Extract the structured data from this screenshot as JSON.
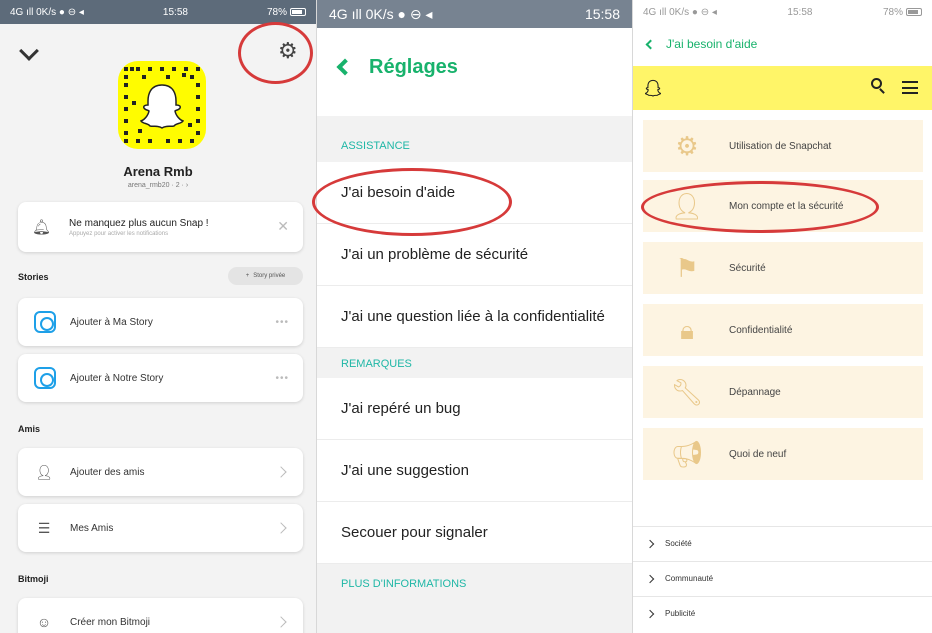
{
  "panel1": {
    "status": {
      "left": "4G ıll 0K/s ● ⊖ ◂",
      "time": "15:58",
      "battery": "78%"
    },
    "profile": {
      "name": "Arena Rmb",
      "username": "arena_rmb20 · 2 · ›"
    },
    "notification": {
      "title": "Ne manquez plus aucun Snap !",
      "subtitle": "Appuyez pour activer les notifications",
      "close": "✕"
    },
    "stories_header": "Stories",
    "private_story_button": "Story privée",
    "stories": [
      {
        "label": "Ajouter à Ma Story"
      },
      {
        "label": "Ajouter à Notre Story"
      }
    ],
    "friends_header": "Amis",
    "friends": [
      {
        "label": "Ajouter des amis"
      },
      {
        "label": "Mes Amis"
      }
    ],
    "bitmoji_header": "Bitmoji",
    "bitmoji": [
      {
        "label": "Créer mon Bitmoji"
      }
    ]
  },
  "panel2": {
    "status": {
      "left": "4G ıll 0K/s ● ⊖ ◂",
      "time": "15:58"
    },
    "title": "Réglages",
    "sections": [
      {
        "header": "ASSISTANCE",
        "items": [
          "J'ai besoin d'aide",
          "J'ai un problème de sécurité",
          "J'ai une question liée à la confidentialité"
        ]
      },
      {
        "header": "REMARQUES",
        "items": [
          "J'ai repéré un bug",
          "J'ai une suggestion",
          "Secouer pour signaler"
        ]
      },
      {
        "header": "PLUS D'INFORMATIONS",
        "items": []
      }
    ]
  },
  "panel3": {
    "status": {
      "left": "4G ıll 0K/s ● ⊖ ◂",
      "time": "15:58",
      "battery": "78%"
    },
    "back_label": "J'ai besoin d'aide",
    "categories": [
      {
        "label": "Utilisation de Snapchat",
        "icon": "ghost-gear-icon"
      },
      {
        "label": "Mon compte et la sécurité",
        "icon": "account-icon"
      },
      {
        "label": "Sécurité",
        "icon": "flag-icon"
      },
      {
        "label": "Confidentialité",
        "icon": "lock-icon"
      },
      {
        "label": "Dépannage",
        "icon": "wrench-icon"
      },
      {
        "label": "Quoi de neuf",
        "icon": "megaphone-icon"
      }
    ],
    "footer": [
      {
        "label": "Société"
      },
      {
        "label": "Communauté"
      },
      {
        "label": "Publicité"
      }
    ]
  },
  "colors": {
    "accent_green": "#18b26c",
    "section_teal": "#1fb7a6",
    "snap_yellow": "#fffc00",
    "highlight_red": "#d63a3a"
  }
}
